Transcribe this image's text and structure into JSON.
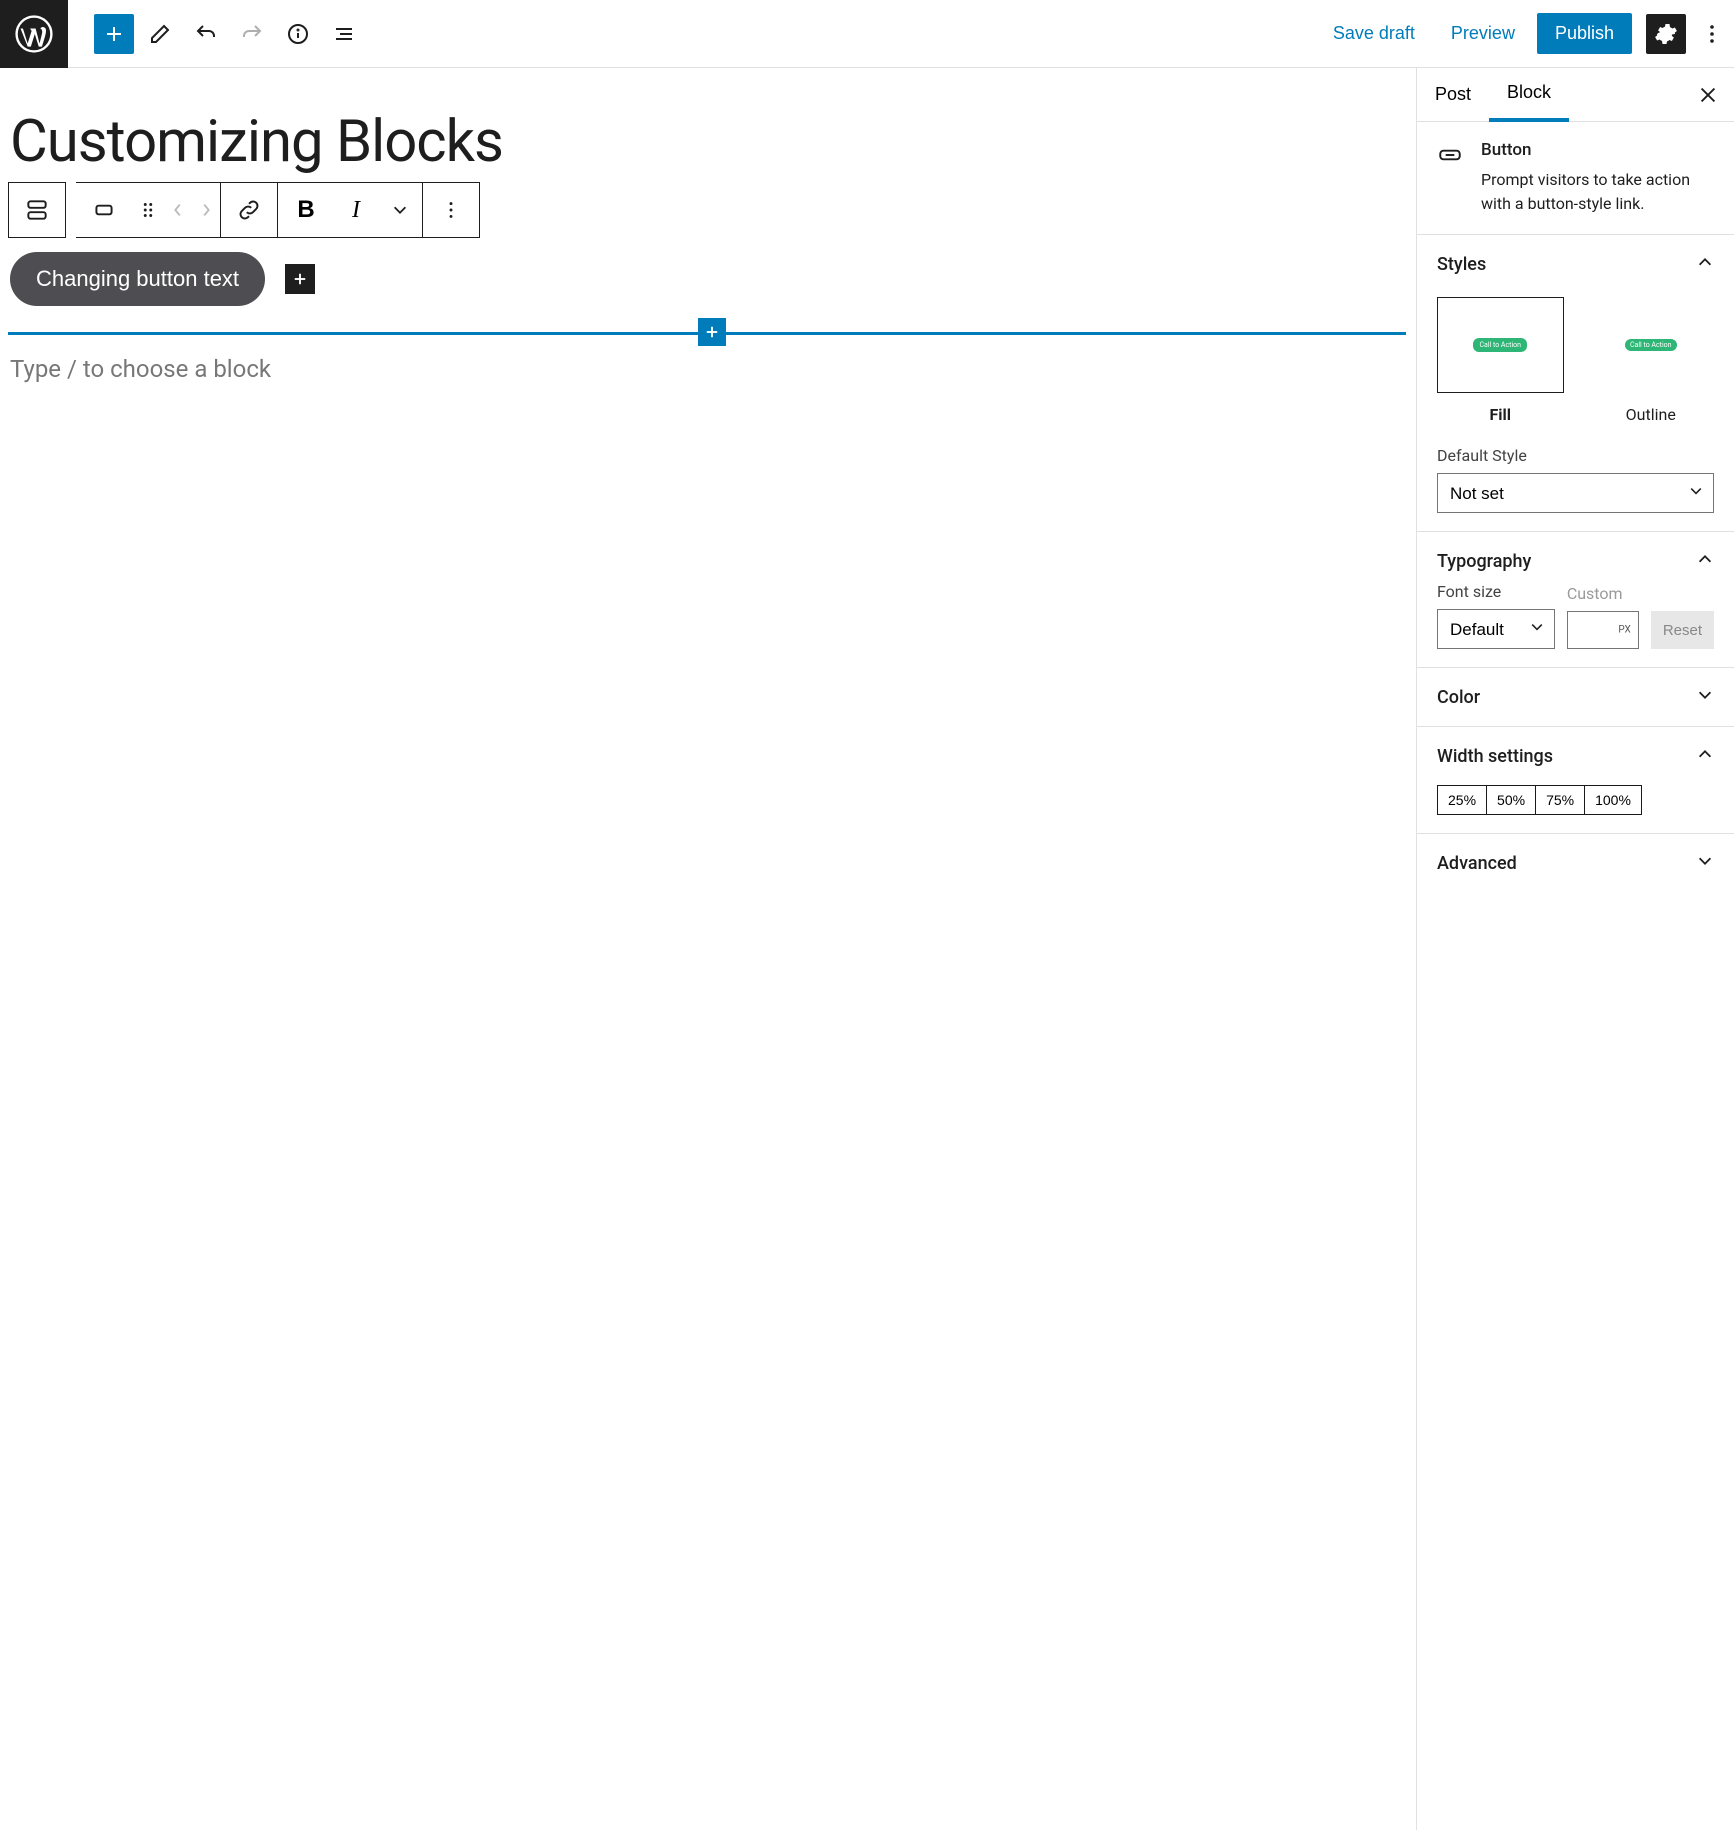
{
  "header": {
    "save_draft": "Save draft",
    "preview": "Preview",
    "publish": "Publish"
  },
  "editor": {
    "title": "Customizing Blocks",
    "button_text": "Changing button text",
    "placeholder": "Type / to choose a block"
  },
  "sidebar": {
    "tabs": {
      "post": "Post",
      "block": "Block"
    },
    "block_info": {
      "name": "Button",
      "description": "Prompt visitors to take action with a button-style link."
    },
    "styles": {
      "title": "Styles",
      "options": [
        {
          "label": "Fill",
          "pill": "Call to Action"
        },
        {
          "label": "Outline",
          "pill": "Call to Action"
        }
      ],
      "default_label": "Default Style",
      "default_value": "Not set"
    },
    "typography": {
      "title": "Typography",
      "font_size_label": "Font size",
      "font_size_value": "Default",
      "custom_label": "Custom",
      "px": "PX",
      "reset": "Reset"
    },
    "color": {
      "title": "Color"
    },
    "width": {
      "title": "Width settings",
      "options": [
        "25%",
        "50%",
        "75%",
        "100%"
      ]
    },
    "advanced": {
      "title": "Advanced"
    }
  }
}
